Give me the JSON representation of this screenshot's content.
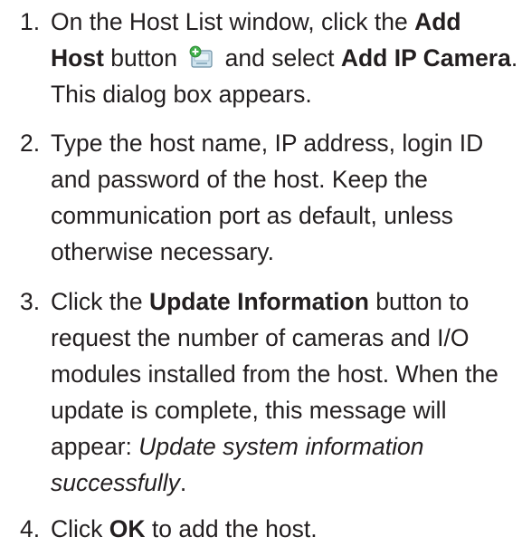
{
  "steps": [
    {
      "number": "1.",
      "parts": {
        "a": "On the Host List window, click the ",
        "b": "Add Host",
        "c": " button ",
        "d": " and select ",
        "e": "Add IP Camera",
        "f": ". This dialog box appears."
      },
      "icon": "add-host-icon"
    },
    {
      "number": "2.",
      "text": "Type the host name, IP address, login ID and password of the host. Keep the communication port as default, unless otherwise necessary."
    },
    {
      "number": "3.",
      "parts": {
        "a": "Click the ",
        "b": "Update Information",
        "c": " button to request the number of cameras and I/O modules installed from the host. When the update is complete, this message will appear: ",
        "d": "Update system information successfully",
        "e": "."
      }
    },
    {
      "number": "4.",
      "parts": {
        "a": "Click ",
        "b": "OK",
        "c": " to add the host."
      }
    }
  ]
}
